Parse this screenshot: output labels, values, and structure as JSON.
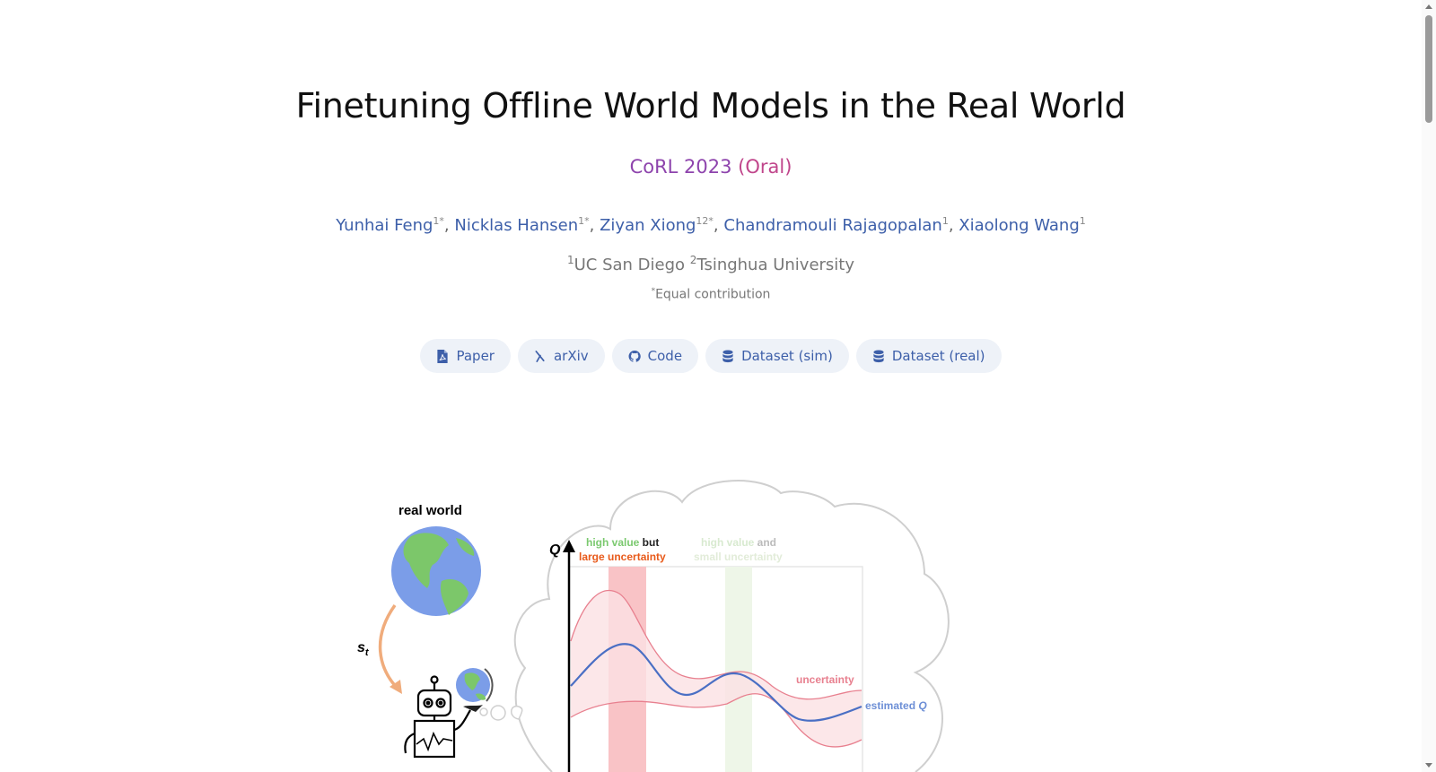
{
  "title": "Finetuning Offline World Models in the Real World",
  "venue": {
    "conference": "CoRL 2023",
    "tag": "(Oral)"
  },
  "authors": [
    {
      "name": "Yunhai Feng",
      "sup": "1*"
    },
    {
      "name": "Nicklas Hansen",
      "sup": "1*"
    },
    {
      "name": "Ziyan Xiong",
      "sup": "12*"
    },
    {
      "name": "Chandramouli Rajagopalan",
      "sup": "1"
    },
    {
      "name": "Xiaolong Wang",
      "sup": "1"
    }
  ],
  "affiliations": [
    {
      "sup": "1",
      "name": "UC San Diego"
    },
    {
      "sup": "2",
      "name": "Tsinghua University"
    }
  ],
  "note": {
    "sup": "*",
    "text": "Equal contribution"
  },
  "links": [
    {
      "label": "Paper",
      "icon": "file-pdf-icon"
    },
    {
      "label": "arXiv",
      "icon": "arxiv-icon"
    },
    {
      "label": "Code",
      "icon": "github-icon"
    },
    {
      "label": "Dataset (sim)",
      "icon": "database-icon"
    },
    {
      "label": "Dataset (real)",
      "icon": "database-icon"
    }
  ],
  "figure": {
    "real_world_label": "real world",
    "state_label": "s",
    "state_sub": "t",
    "q_axis_label": "Q",
    "region1_line1_a": "high value",
    "region1_line1_b": " but",
    "region1_line2": "large uncertainty",
    "region2_line1_a": "high value",
    "region2_line1_b": " and",
    "region2_line2": "small uncertainty",
    "uncertainty_label": "uncertainty",
    "estimated_label": "estimated ",
    "estimated_q": "Q"
  },
  "colors": {
    "author_link": "#3d5fa9",
    "venue": "#8e44ad",
    "venue_tag": "#c0458b",
    "estimated_q": "#4a6fc4",
    "uncertainty": "#e8808f",
    "high_value": "#7bc96f",
    "large_uncertainty": "#e85a1a"
  }
}
